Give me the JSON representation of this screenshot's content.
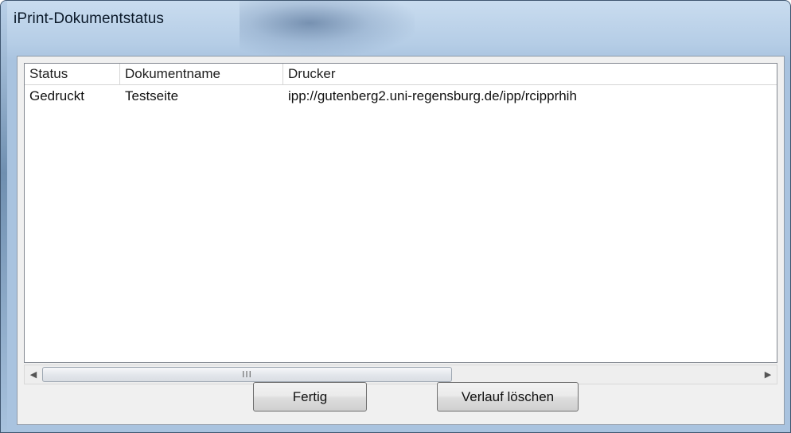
{
  "window": {
    "title": "iPrint-Dokumentstatus"
  },
  "list": {
    "columns": [
      "Status",
      "Dokumentname",
      "Drucker"
    ],
    "rows": [
      {
        "status": "Gedruckt",
        "name": "Testseite",
        "drucker": "ipp://gutenberg2.uni-regensburg.de/ipp/rcipprhih"
      }
    ]
  },
  "scrollbar": {
    "grip": "III",
    "left_icon": "triangle-left-icon",
    "right_icon": "triangle-right-icon"
  },
  "buttons": {
    "done_label": "Fertig",
    "clear_history_label": "Verlauf löschen"
  },
  "colors": {
    "title_bar": "#b5cde6",
    "dialog_bg": "#f0f0f0"
  }
}
